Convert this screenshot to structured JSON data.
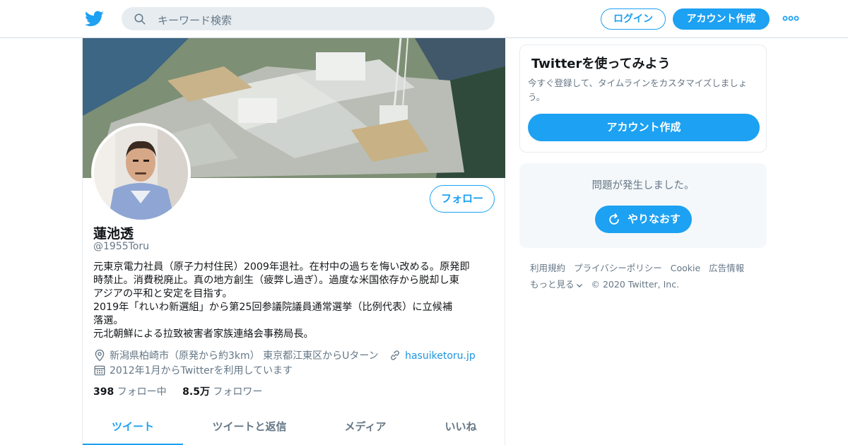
{
  "header": {
    "search_placeholder": "キーワード検索",
    "login_label": "ログイン",
    "signup_label": "アカウント作成",
    "brand_color": "#1da1f2"
  },
  "profile": {
    "display_name": "蓮池透",
    "handle": "@1955Toru",
    "follow_label": "フォロー",
    "bio_lines": [
      "元東京電力社員（原子力村住民）2009年退社。在村中の過ちを悔い改める。原発即",
      "時禁止。消費税廃止。真の地方創生（疲弊し過ぎ）。過度な米国依存から脱却し東",
      "アジアの平和と安定を目指す。",
      "2019年「れいわ新選組」から第25回参議院議員通常選挙（比例代表）に立候補",
      "落選。",
      "元北朝鮮による拉致被害者家族連絡会事務局長。"
    ],
    "location": "新潟県柏崎市（原発から約3km） 東京都江東区からUターン",
    "website": "hasuiketoru.jp",
    "joined": "2012年1月からTwitterを利用しています",
    "following_count": "398",
    "following_label": "フォロー中",
    "followers_count": "8.5万",
    "followers_label": "フォロワー",
    "tabs": [
      "ツイート",
      "ツイートと返信",
      "メディア",
      "いいね"
    ],
    "active_tab": "ツイート"
  },
  "signup_card": {
    "title": "Twitterを使ってみよう",
    "description": "今すぐ登録して、タイムラインをカスタマイズしましょう。",
    "cta_label": "アカウント作成"
  },
  "error_card": {
    "message": "問題が発生しました。",
    "retry_label": "やりなおす"
  },
  "footer": {
    "links": [
      "利用規約",
      "プライバシーポリシー",
      "Cookie",
      "広告情報",
      "もっと見る"
    ],
    "copyright": "© 2020 Twitter, Inc."
  }
}
